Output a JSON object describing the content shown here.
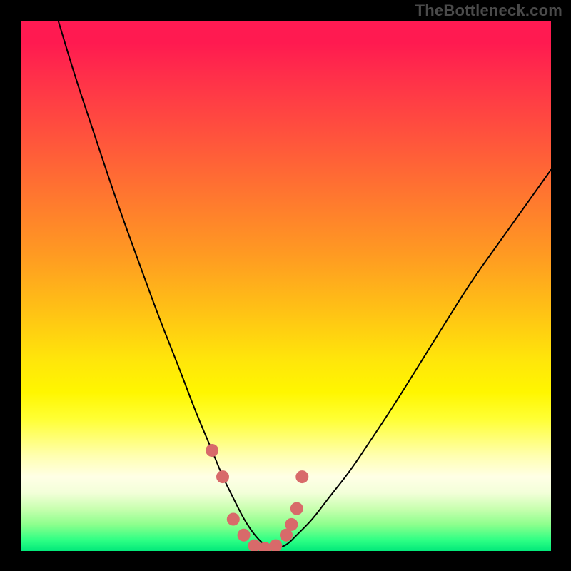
{
  "watermark": {
    "text": "TheBottleneck.com"
  },
  "colors": {
    "background": "#000000",
    "curve": "#000000",
    "markers": "#d86a6a"
  },
  "chart_data": {
    "type": "line",
    "title": "",
    "xlabel": "",
    "ylabel": "",
    "xlim": [
      0,
      100
    ],
    "ylim": [
      0,
      100
    ],
    "grid": false,
    "legend": false,
    "series": [
      {
        "name": "bottleneck-curve",
        "x": [
          7,
          10,
          14,
          18,
          22,
          26,
          30,
          33,
          36,
          38,
          40,
          42,
          44,
          46,
          48,
          50,
          52,
          55,
          58,
          62,
          66,
          70,
          75,
          80,
          85,
          90,
          95,
          100
        ],
        "y": [
          100,
          90,
          78,
          66,
          55,
          44,
          34,
          26,
          19,
          14,
          10,
          6,
          3,
          1,
          0.5,
          1,
          3,
          6,
          10,
          15,
          21,
          27,
          35,
          43,
          51,
          58,
          65,
          72
        ]
      }
    ],
    "markers": {
      "name": "highlight-points",
      "x": [
        36,
        38,
        40,
        42,
        44,
        46,
        48,
        50,
        51,
        52,
        53
      ],
      "y": [
        19,
        14,
        6,
        3,
        1,
        0.5,
        1,
        3,
        5,
        8,
        14
      ]
    },
    "gradient_stops": [
      {
        "pos": 0,
        "color": "#ff1a52"
      },
      {
        "pos": 24,
        "color": "#ff5a3a"
      },
      {
        "pos": 54,
        "color": "#ffbf16"
      },
      {
        "pos": 75,
        "color": "#ffff33"
      },
      {
        "pos": 92,
        "color": "#c9ffb0"
      },
      {
        "pos": 100,
        "color": "#02e87a"
      }
    ]
  }
}
